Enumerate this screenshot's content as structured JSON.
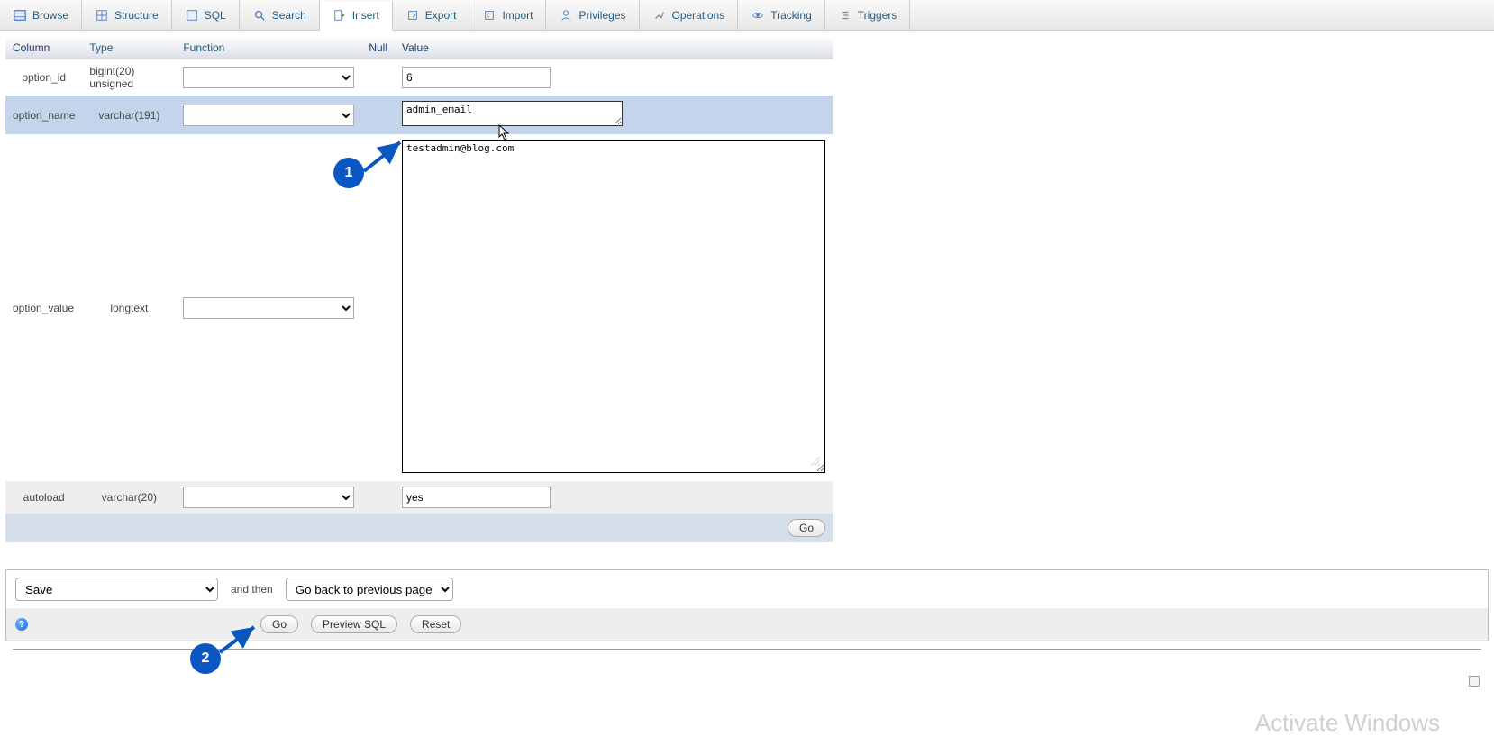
{
  "tabs": [
    {
      "label": "Browse",
      "icon": "browse"
    },
    {
      "label": "Structure",
      "icon": "structure"
    },
    {
      "label": "SQL",
      "icon": "sql"
    },
    {
      "label": "Search",
      "icon": "search"
    },
    {
      "label": "Insert",
      "icon": "insert",
      "active": true
    },
    {
      "label": "Export",
      "icon": "export"
    },
    {
      "label": "Import",
      "icon": "import"
    },
    {
      "label": "Privileges",
      "icon": "privileges"
    },
    {
      "label": "Operations",
      "icon": "operations"
    },
    {
      "label": "Tracking",
      "icon": "tracking"
    },
    {
      "label": "Triggers",
      "icon": "triggers"
    }
  ],
  "headers": {
    "column": "Column",
    "type": "Type",
    "function": "Function",
    "null": "Null",
    "value": "Value"
  },
  "rows": [
    {
      "column": "option_id",
      "type": "bigint(20) unsigned",
      "value": "6",
      "input_kind": "text"
    },
    {
      "column": "option_name",
      "type": "varchar(191)",
      "value": "admin_email",
      "input_kind": "textarea_small",
      "active": true
    },
    {
      "column": "option_value",
      "type": "longtext",
      "value": "testadmin@blog.com",
      "input_kind": "textarea_big"
    },
    {
      "column": "autoload",
      "type": "varchar(20)",
      "value": "yes",
      "input_kind": "text"
    }
  ],
  "buttons": {
    "go_row": "Go",
    "go": "Go",
    "preview_sql": "Preview SQL",
    "reset": "Reset"
  },
  "footer": {
    "save_option": "Save",
    "and_then": "and then",
    "after_option": "Go back to previous page"
  },
  "annotations": {
    "badge1": "1",
    "badge2": "2"
  },
  "watermark": "Activate Windows"
}
